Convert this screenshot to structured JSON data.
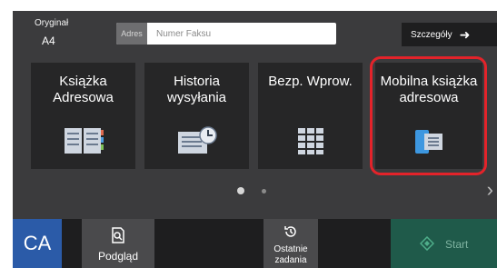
{
  "header": {
    "original_label": "Oryginał",
    "original_value": "A4",
    "address_button_label": "Adres",
    "fax_number_placeholder": "Numer Faksu",
    "details_button_label": "Szczegóły"
  },
  "tiles": [
    {
      "label": "Książka\nAdresowa",
      "icon": "address-book-icon"
    },
    {
      "label": "Historia\nwysyłania",
      "icon": "send-history-icon"
    },
    {
      "label": "Bezp. Wprow.",
      "icon": "keypad-icon"
    },
    {
      "label": "Mobilna książka\nadresowa",
      "icon": "mobile-address-book-icon",
      "selected": true
    }
  ],
  "pagination": {
    "pages": 2,
    "current": 1
  },
  "bottom_bar": {
    "ca_label": "CA",
    "preview_label": "Podgląd",
    "recent_jobs_label": "Ostatnie\nzadania",
    "start_label": "Start"
  },
  "colors": {
    "background": "#3b3b3d",
    "tile": "#262627",
    "selection_highlight": "#e3232a",
    "ca_button": "#2b5ba8",
    "start_button": "#1f5a4a"
  }
}
